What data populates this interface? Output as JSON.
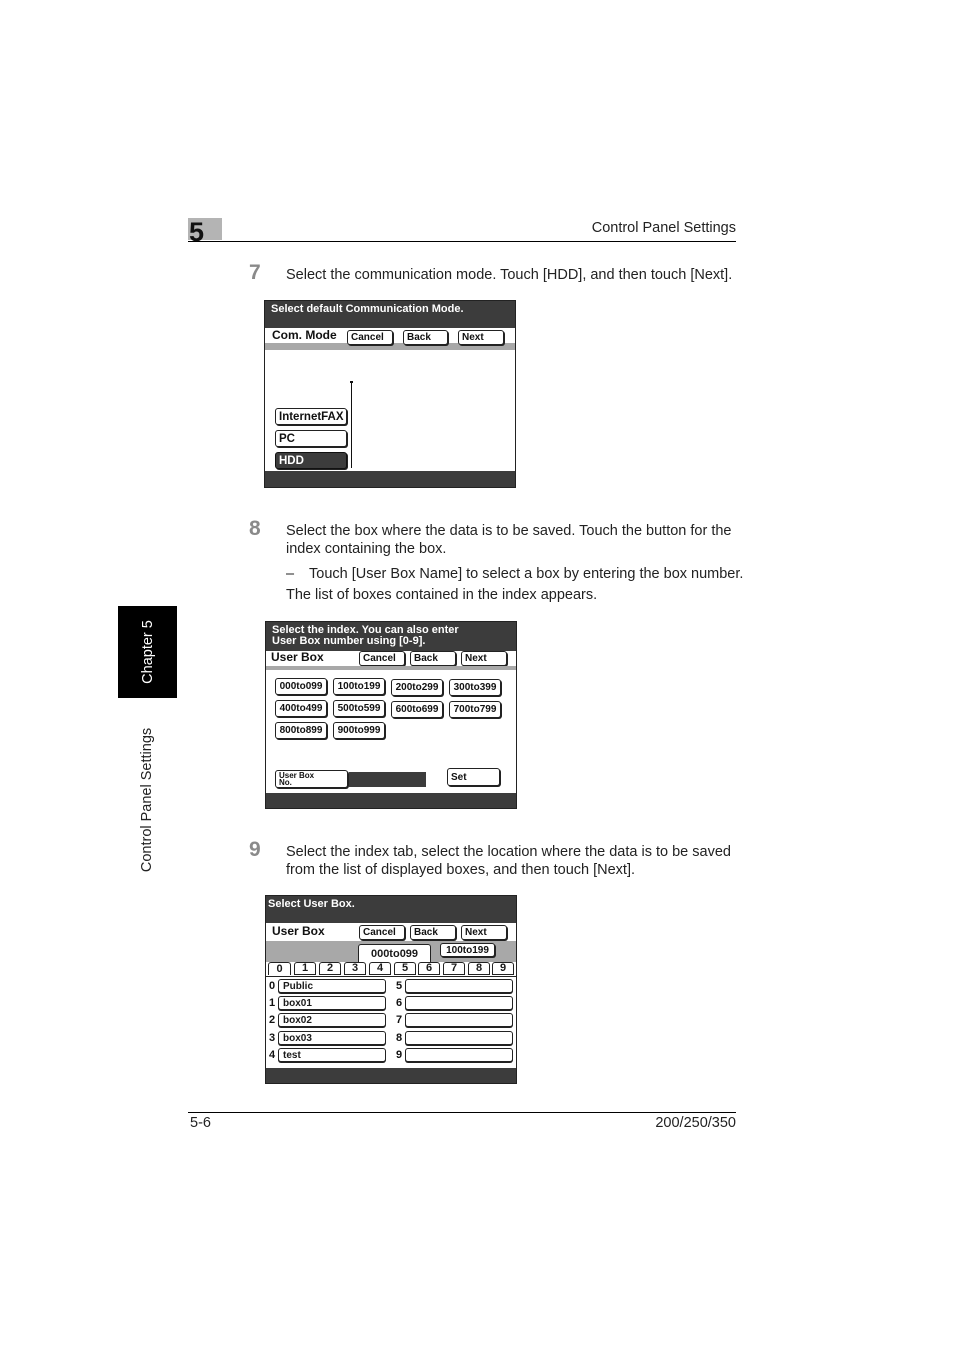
{
  "header": {
    "chapter_number": "5",
    "section_title": "Control Panel Settings"
  },
  "side_tab": {
    "chapter_label": "Chapter 5",
    "section_label": "Control Panel Settings"
  },
  "steps": [
    {
      "number": "7",
      "text": "Select the communication mode. Touch [HDD], and then touch [Next]."
    },
    {
      "number": "8",
      "text": "Select the box where the data is to be saved. Touch the button for the index containing the box.",
      "sub_bullet": "Touch [User Box Name] to select a box by entering the box number.",
      "bullet_mark": "–",
      "note": "The list of boxes contained in the index appears."
    },
    {
      "number": "9",
      "text": "Select the index tab, select the location where the data is to be saved from the list of displayed boxes, and then touch [Next]."
    }
  ],
  "screen1": {
    "title": "Select default Communication Mode.",
    "label": "Com. Mode",
    "buttons": {
      "cancel": "Cancel",
      "back": "Back",
      "next": "Next"
    },
    "modes": [
      "InternetFAX",
      "PC",
      "HDD"
    ],
    "selected_mode": "HDD"
  },
  "screen2": {
    "title_line1": "Select the index. You can also enter",
    "title_line2": "User Box number using [0-9].",
    "label": "User Box",
    "buttons": {
      "cancel": "Cancel",
      "back": "Back",
      "next": "Next",
      "set": "Set"
    },
    "indexes": [
      "000to099",
      "100to199",
      "200to299",
      "300to399",
      "400to499",
      "500to599",
      "600to699",
      "700to799",
      "800to899",
      "900to999"
    ],
    "user_box_no_label_line1": "User Box",
    "user_box_no_label_line2": "No.",
    "user_box_no_value": ""
  },
  "screen3": {
    "title": "Select User Box.",
    "label": "User Box",
    "buttons": {
      "cancel": "Cancel",
      "back": "Back",
      "next": "Next"
    },
    "range_tabs": [
      "000to099",
      "100to199"
    ],
    "active_range": "000to099",
    "digit_tabs": [
      "0",
      "1",
      "2",
      "3",
      "4",
      "5",
      "6",
      "7",
      "8",
      "9"
    ],
    "active_digit": "0",
    "boxes": [
      {
        "index": "0",
        "name": "Public"
      },
      {
        "index": "1",
        "name": "box01"
      },
      {
        "index": "2",
        "name": "box02"
      },
      {
        "index": "3",
        "name": "box03"
      },
      {
        "index": "4",
        "name": "test"
      },
      {
        "index": "5",
        "name": ""
      },
      {
        "index": "6",
        "name": ""
      },
      {
        "index": "7",
        "name": ""
      },
      {
        "index": "8",
        "name": ""
      },
      {
        "index": "9",
        "name": ""
      }
    ]
  },
  "footer": {
    "page_number": "5-6",
    "model": "200/250/350"
  }
}
